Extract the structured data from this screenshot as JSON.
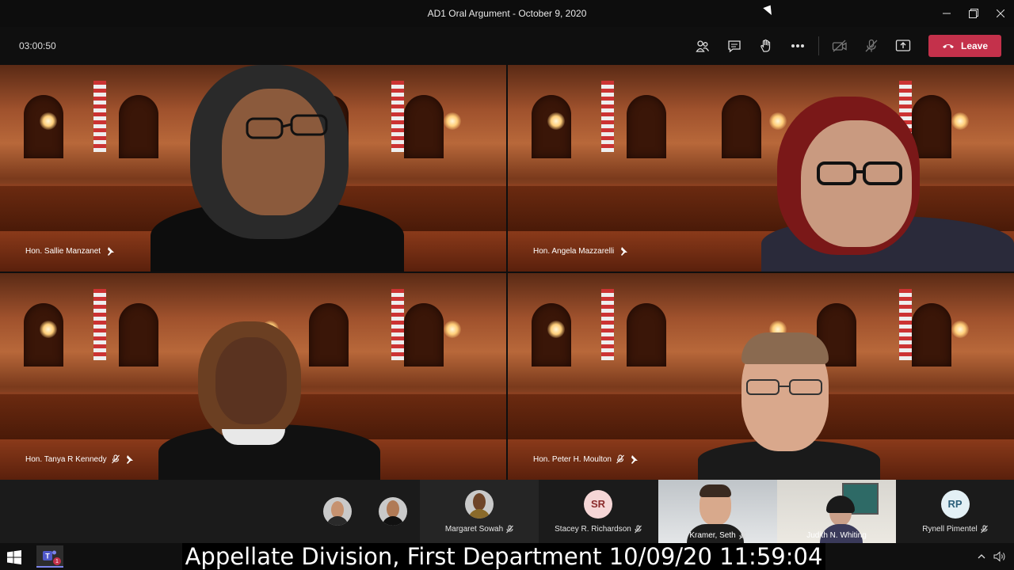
{
  "window": {
    "title": "AD1 Oral Argument - October 9, 2020",
    "minimize_icon": "minimize-icon",
    "restore_icon": "restore-icon",
    "close_icon": "close-icon"
  },
  "call": {
    "timer": "03:00:50",
    "toolbar": {
      "participants_icon": "people-icon",
      "chat_icon": "chat-icon",
      "raise_hand_icon": "hand-icon",
      "more_icon": "more-icon",
      "camera_icon": "camera-off-icon",
      "mic_icon": "mic-off-icon",
      "share_icon": "share-icon",
      "leave_label": "Leave"
    },
    "leave_color": "#c4314b"
  },
  "tiles": [
    {
      "name": "Hon. Sallie Manzanet",
      "muted": false,
      "pinned": true
    },
    {
      "name": "Hon. Angela Mazzarelli",
      "muted": false,
      "pinned": true
    },
    {
      "name": "Hon. Tanya R Kennedy",
      "muted": true,
      "pinned": true
    },
    {
      "name": "Hon. Peter H. Moulton",
      "muted": true,
      "pinned": true
    }
  ],
  "strip": {
    "participants": [
      {
        "name": "",
        "type": "photo"
      },
      {
        "name": "",
        "type": "photo"
      },
      {
        "name": "Margaret Sowah",
        "type": "photo",
        "muted": true
      },
      {
        "name": "Stacey R. Richardson",
        "type": "initials",
        "initials": "SR",
        "muted": true
      },
      {
        "name": "Kramer, Seth",
        "type": "video",
        "muted": true
      },
      {
        "name": "Judith N. Whiting",
        "type": "video",
        "muted": false
      },
      {
        "name": "Rynell Pimentel",
        "type": "initials",
        "initials": "RP",
        "muted": true
      }
    ]
  },
  "caption": "Appellate Division, First Department 10/09/20 11:59:04",
  "taskbar": {
    "start_icon": "windows-start-icon",
    "teams_icon": "teams-icon",
    "teams_badge": "1"
  }
}
